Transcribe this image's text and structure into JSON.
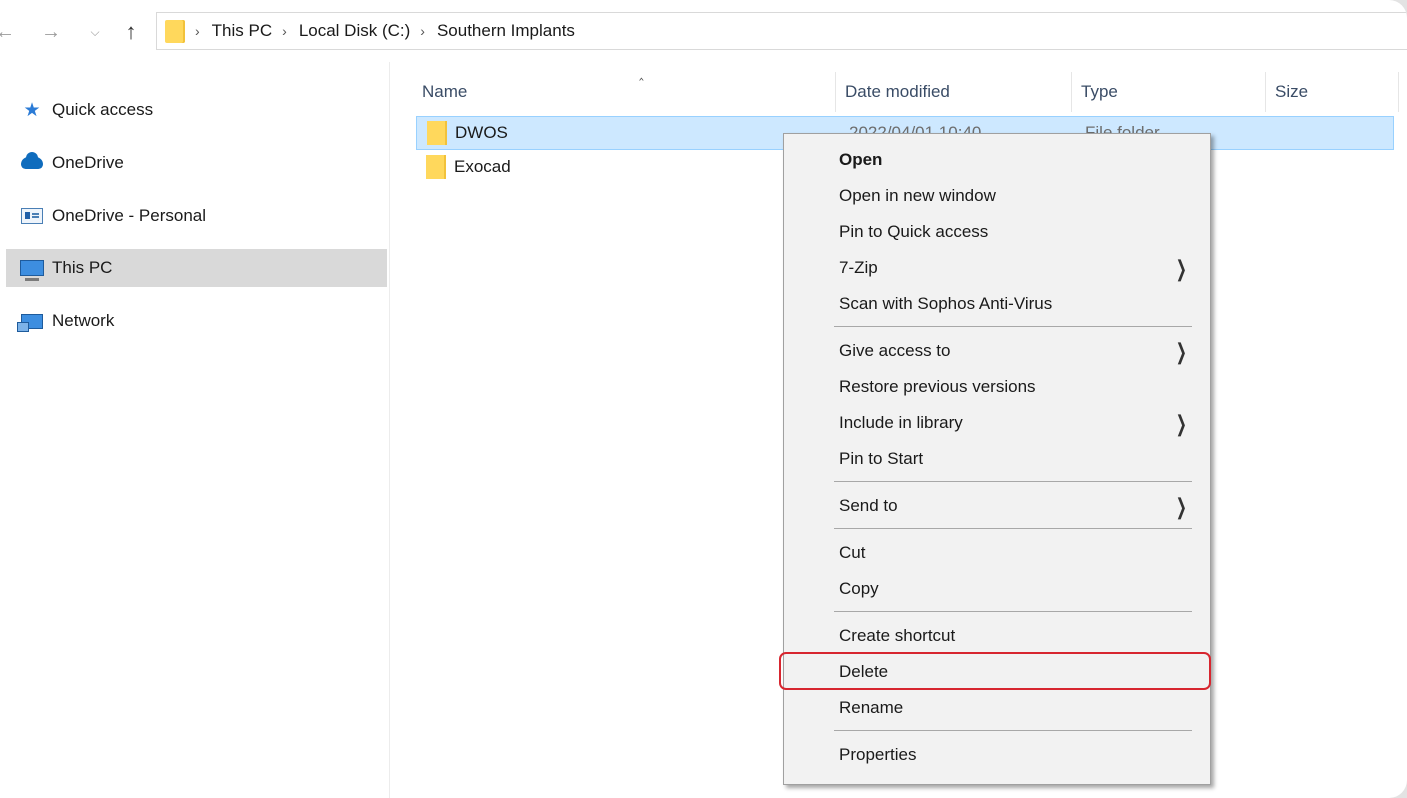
{
  "addressbar": {
    "back_icon": "back-arrow-icon",
    "forward_icon": "forward-arrow-icon",
    "recent_icon": "chevron-down-icon",
    "up_icon": "up-arrow-icon",
    "breadcrumb": [
      "This PC",
      "Local Disk (C:)",
      "Southern Implants"
    ]
  },
  "navpane": {
    "items": [
      {
        "label": "Quick access",
        "icon": "star-icon"
      },
      {
        "label": "OneDrive",
        "icon": "cloud-icon"
      },
      {
        "label": "OneDrive - Personal",
        "icon": "drive-icon"
      },
      {
        "label": "This PC",
        "icon": "computer-icon"
      },
      {
        "label": "Network",
        "icon": "network-icon"
      }
    ]
  },
  "columns": {
    "name": "Name",
    "date": "Date modified",
    "type": "Type",
    "size": "Size"
  },
  "files": [
    {
      "name": "DWOS",
      "date": "2022/04/01 10:40",
      "type": "File folder"
    },
    {
      "name": "Exocad",
      "date": "",
      "type": ""
    }
  ],
  "context_menu": {
    "items": [
      {
        "label": "Open"
      },
      {
        "label": "Open in new window"
      },
      {
        "label": "Pin to Quick access"
      },
      {
        "label": "7-Zip"
      },
      {
        "label": "Scan with Sophos Anti-Virus"
      },
      {
        "label": "Give access to"
      },
      {
        "label": "Restore previous versions"
      },
      {
        "label": "Include in library"
      },
      {
        "label": "Pin to Start"
      },
      {
        "label": "Send to"
      },
      {
        "label": "Cut"
      },
      {
        "label": "Copy"
      },
      {
        "label": "Create shortcut"
      },
      {
        "label": "Delete"
      },
      {
        "label": "Rename"
      },
      {
        "label": "Properties"
      }
    ],
    "highlighted": "Delete",
    "highlight_color": "#d7262f"
  },
  "colors": {
    "selection_bg": "#cde8ff",
    "selection_border": "#99d1ff",
    "folder": "#ffd85c"
  }
}
